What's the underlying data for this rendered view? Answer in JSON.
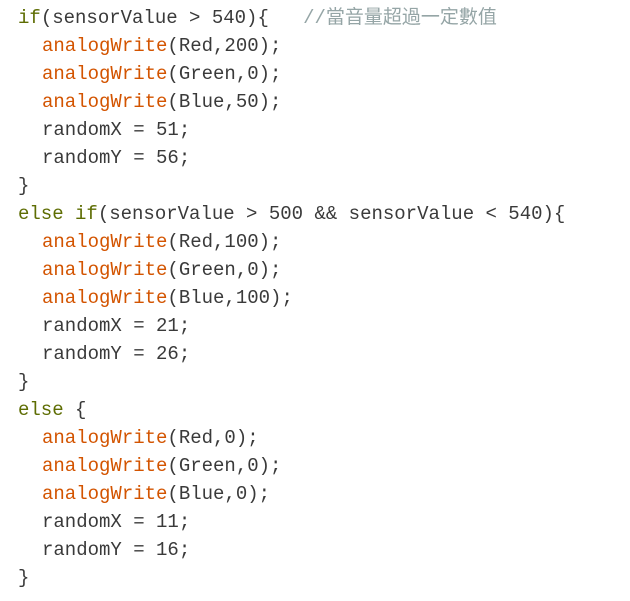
{
  "code": {
    "lines": [
      {
        "indent": 0,
        "segments": [
          {
            "t": "kw",
            "s": "if"
          },
          {
            "t": "tx",
            "s": "(sensorValue > 540){   "
          },
          {
            "t": "cm",
            "s": "//當音量超過一定數值"
          }
        ]
      },
      {
        "indent": 1,
        "segments": [
          {
            "t": "fn",
            "s": "analogWrite"
          },
          {
            "t": "tx",
            "s": "(Red,200);"
          }
        ]
      },
      {
        "indent": 1,
        "segments": [
          {
            "t": "fn",
            "s": "analogWrite"
          },
          {
            "t": "tx",
            "s": "(Green,0);"
          }
        ]
      },
      {
        "indent": 1,
        "segments": [
          {
            "t": "fn",
            "s": "analogWrite"
          },
          {
            "t": "tx",
            "s": "(Blue,50);"
          }
        ]
      },
      {
        "indent": 1,
        "segments": [
          {
            "t": "tx",
            "s": "randomX = 51;"
          }
        ]
      },
      {
        "indent": 1,
        "segments": [
          {
            "t": "tx",
            "s": "randomY = 56;"
          }
        ]
      },
      {
        "indent": 0,
        "segments": [
          {
            "t": "tx",
            "s": "}"
          }
        ]
      },
      {
        "indent": 0,
        "segments": [
          {
            "t": "kw",
            "s": "else"
          },
          {
            "t": "tx",
            "s": " "
          },
          {
            "t": "kw",
            "s": "if"
          },
          {
            "t": "tx",
            "s": "(sensorValue > 500 && sensorValue < 540){"
          }
        ]
      },
      {
        "indent": 1,
        "segments": [
          {
            "t": "fn",
            "s": "analogWrite"
          },
          {
            "t": "tx",
            "s": "(Red,100);"
          }
        ]
      },
      {
        "indent": 1,
        "segments": [
          {
            "t": "fn",
            "s": "analogWrite"
          },
          {
            "t": "tx",
            "s": "(Green,0);"
          }
        ]
      },
      {
        "indent": 1,
        "segments": [
          {
            "t": "fn",
            "s": "analogWrite"
          },
          {
            "t": "tx",
            "s": "(Blue,100);"
          }
        ]
      },
      {
        "indent": 1,
        "segments": [
          {
            "t": "tx",
            "s": "randomX = 21;"
          }
        ]
      },
      {
        "indent": 1,
        "segments": [
          {
            "t": "tx",
            "s": "randomY = 26;"
          }
        ]
      },
      {
        "indent": 0,
        "segments": [
          {
            "t": "tx",
            "s": "}"
          }
        ]
      },
      {
        "indent": 0,
        "segments": [
          {
            "t": "kw",
            "s": "else"
          },
          {
            "t": "tx",
            "s": " {"
          }
        ]
      },
      {
        "indent": 1,
        "segments": [
          {
            "t": "fn",
            "s": "analogWrite"
          },
          {
            "t": "tx",
            "s": "(Red,0);"
          }
        ]
      },
      {
        "indent": 1,
        "segments": [
          {
            "t": "fn",
            "s": "analogWrite"
          },
          {
            "t": "tx",
            "s": "(Green,0);"
          }
        ]
      },
      {
        "indent": 1,
        "segments": [
          {
            "t": "fn",
            "s": "analogWrite"
          },
          {
            "t": "tx",
            "s": "(Blue,0);"
          }
        ]
      },
      {
        "indent": 1,
        "segments": [
          {
            "t": "tx",
            "s": "randomX = 11;"
          }
        ]
      },
      {
        "indent": 1,
        "segments": [
          {
            "t": "tx",
            "s": "randomY = 16;"
          }
        ]
      },
      {
        "indent": 0,
        "segments": [
          {
            "t": "tx",
            "s": "}"
          }
        ]
      }
    ]
  },
  "colors": {
    "keyword": "#5e6d03",
    "function": "#d35400",
    "comment": "#95a5a6",
    "text": "#3a3a3a",
    "background": "#ffffff"
  }
}
